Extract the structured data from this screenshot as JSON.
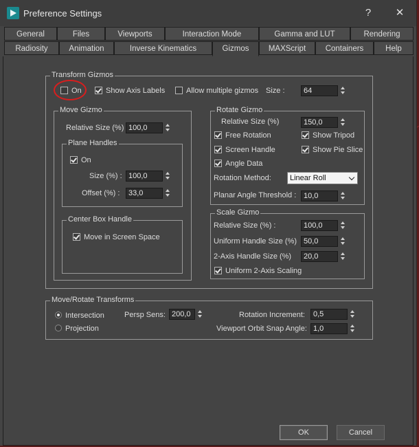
{
  "window": {
    "title": "Preference Settings",
    "help": "?",
    "close": "✕"
  },
  "tabs_row1": [
    "General",
    "Files",
    "Viewports",
    "Interaction Mode",
    "Gamma and LUT",
    "Rendering"
  ],
  "tabs_row2": [
    "Radiosity",
    "Animation",
    "Inverse Kinematics",
    "Gizmos",
    "MAXScript",
    "Containers",
    "Help"
  ],
  "active_tab": "Gizmos",
  "transform_gizmos": {
    "title": "Transform Gizmos",
    "on_label": "On",
    "on_checked": false,
    "show_axis_label": "Show Axis Labels",
    "show_axis_checked": true,
    "allow_multiple_label": "Allow multiple gizmos",
    "allow_multiple_checked": false,
    "size_label": "Size :",
    "size_value": "64"
  },
  "move_gizmo": {
    "title": "Move Gizmo",
    "relative_size_label": "Relative Size (%)",
    "relative_size_value": "100,0",
    "plane_handles": {
      "title": "Plane Handles",
      "on_label": "On",
      "on_checked": true,
      "size_label": "Size (%) :",
      "size_value": "100,0",
      "offset_label": "Offset (%) :",
      "offset_value": "33,0"
    },
    "center_box": {
      "title": "Center Box Handle",
      "move_screen_label": "Move in Screen Space",
      "move_screen_checked": true
    }
  },
  "rotate_gizmo": {
    "title": "Rotate Gizmo",
    "relative_size_label": "Relative Size (%)",
    "relative_size_value": "150,0",
    "free_rotation_label": "Free Rotation",
    "free_rotation_checked": true,
    "show_tripod_label": "Show Tripod",
    "show_tripod_checked": true,
    "screen_handle_label": "Screen Handle",
    "screen_handle_checked": true,
    "show_pie_label": "Show Pie Slice",
    "show_pie_checked": true,
    "angle_data_label": "Angle Data",
    "angle_data_checked": true,
    "rotation_method_label": "Rotation Method:",
    "rotation_method_value": "Linear Roll",
    "planar_threshold_label": "Planar Angle Threshold :",
    "planar_threshold_value": "10,0"
  },
  "scale_gizmo": {
    "title": "Scale Gizmo",
    "relative_size_label": "Relative Size (%) :",
    "relative_size_value": "100,0",
    "uniform_handle_label": "Uniform Handle Size (%)",
    "uniform_handle_value": "50,0",
    "two_axis_label": "2-Axis Handle Size (%)",
    "two_axis_value": "20,0",
    "uniform_2axis_label": "Uniform 2-Axis Scaling",
    "uniform_2axis_checked": true
  },
  "move_rotate": {
    "title": "Move/Rotate Transforms",
    "intersection_label": "Intersection",
    "intersection_selected": true,
    "projection_label": "Projection",
    "projection_selected": false,
    "persp_label": "Persp Sens:",
    "persp_value": "200,0",
    "rotation_inc_label": "Rotation Increment:",
    "rotation_inc_value": "0,5",
    "orbit_snap_label": "Viewport Orbit Snap Angle:",
    "orbit_snap_value": "1,0"
  },
  "buttons": {
    "ok": "OK",
    "cancel": "Cancel"
  }
}
